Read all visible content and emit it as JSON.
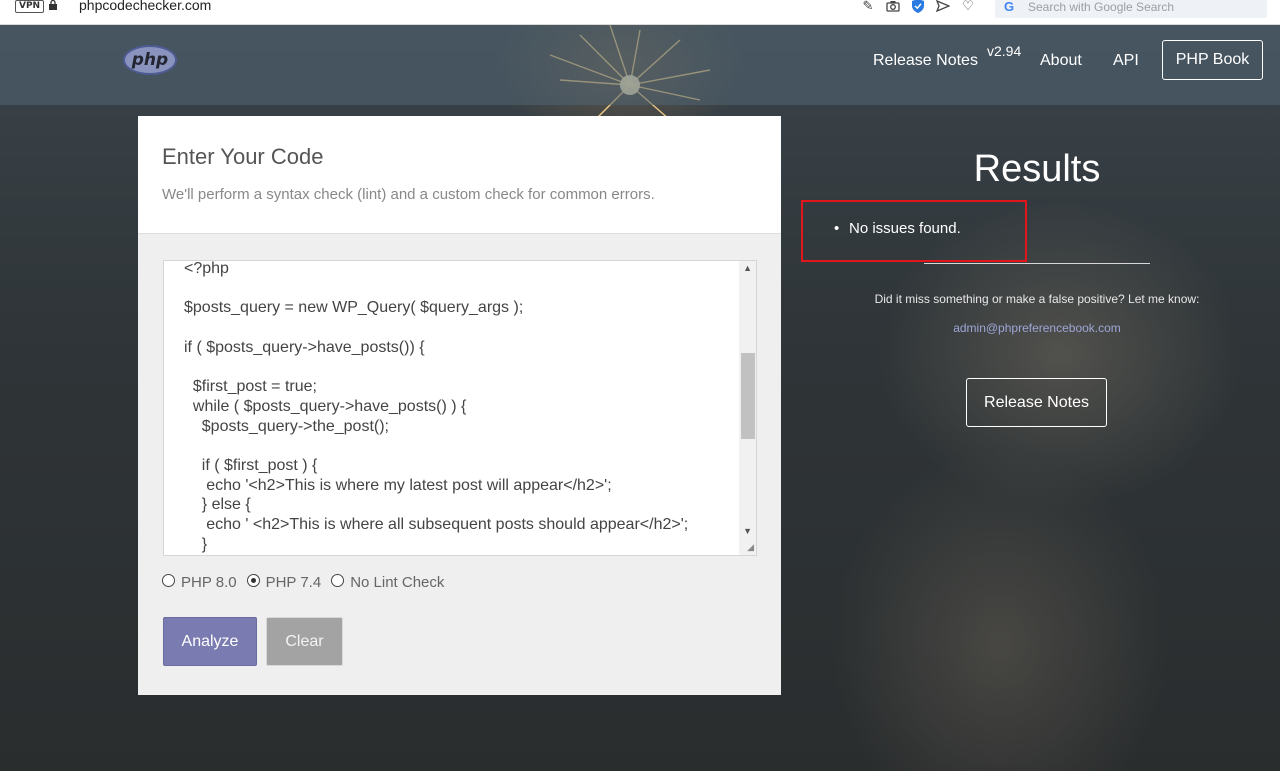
{
  "browser": {
    "vpn_label": "VPN",
    "url": "phpcodechecker.com",
    "search_placeholder": "Search with Google Search",
    "search_logo": "G",
    "icons": [
      "edit-icon",
      "camera-icon",
      "shield-icon",
      "send-icon",
      "heart-icon"
    ]
  },
  "nav": {
    "logo_text": "php",
    "release_notes": "Release Notes",
    "version": "v2.94",
    "about": "About",
    "api": "API",
    "php_book": "PHP Book"
  },
  "card": {
    "title": "Enter Your Code",
    "subtitle": "We'll perform a syntax check (lint) and a custom check for common errors.",
    "code_lines": [
      "<?php",
      "",
      "$posts_query = new WP_Query( $query_args );",
      "",
      "if ( $posts_query->have_posts()) {",
      "",
      "  $first_post = true;",
      "  while ( $posts_query->have_posts() ) {",
      "    $posts_query->the_post();",
      "",
      "    if ( $first_post ) {",
      "     echo '<h2>This is where my latest post will appear</h2>';",
      "    } else {",
      "     echo ' <h2>This is where all subsequent posts should appear</h2>';",
      "    }"
    ],
    "radios": [
      {
        "label": "PHP 8.0",
        "checked": false
      },
      {
        "label": "PHP 7.4",
        "checked": true
      },
      {
        "label": "No Lint Check",
        "checked": false
      }
    ],
    "analyze_label": "Analyze",
    "clear_label": "Clear"
  },
  "results": {
    "title": "Results",
    "issues": [
      "No issues found."
    ],
    "feedback": "Did it miss something or make a false positive? Let me know:",
    "email": "admin@phpreferencebook.com",
    "release_notes_button": "Release Notes"
  },
  "colors": {
    "analyze_bg": "#7a7bb0",
    "clear_bg": "#a3a3a3",
    "highlight_border": "#e0161a",
    "email_link": "#9da6d6"
  }
}
